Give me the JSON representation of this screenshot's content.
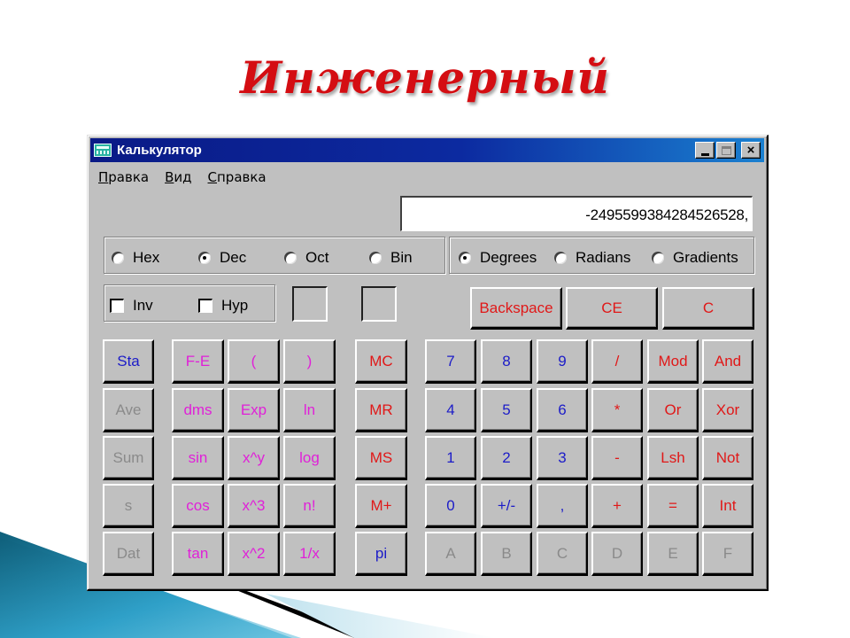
{
  "slide": {
    "title": "Инженерный",
    "title_color": "#d40d12",
    "accent_color": "#1a7fa0"
  },
  "window": {
    "title": "Калькулятор",
    "icon": "calculator-icon",
    "controls": {
      "minimize": "minimize-icon",
      "maximize": "maximize-icon",
      "close": "×"
    }
  },
  "menu": [
    {
      "label": "Правка",
      "mnemonic": "П",
      "rest": "равка"
    },
    {
      "label": "Вид",
      "mnemonic": "В",
      "rest": "ид"
    },
    {
      "label": "Справка",
      "mnemonic": "С",
      "rest": "правка"
    }
  ],
  "display": {
    "value": "-2495599384284526528,"
  },
  "number_system": {
    "options": [
      "Hex",
      "Dec",
      "Oct",
      "Bin"
    ],
    "selected": "Dec"
  },
  "angle_units": {
    "options": [
      "Degrees",
      "Radians",
      "Gradients"
    ],
    "selected": "Degrees"
  },
  "modifiers": [
    {
      "label": "Inv",
      "checked": false
    },
    {
      "label": "Hyp",
      "checked": false
    }
  ],
  "colors": {
    "blue": "#1c1cc8",
    "magenta": "#e020d8",
    "red": "#e01818",
    "gray": "#8a8a8a"
  },
  "edit_buttons": [
    "Backspace",
    "CE",
    "C"
  ],
  "stat_buttons": [
    {
      "label": "Sta",
      "color": "blue"
    },
    {
      "label": "Ave",
      "color": "gray"
    },
    {
      "label": "Sum",
      "color": "gray"
    },
    {
      "label": "s",
      "color": "gray"
    },
    {
      "label": "Dat",
      "color": "gray"
    }
  ],
  "function_buttons": [
    [
      "F-E",
      "(",
      ")"
    ],
    [
      "dms",
      "Exp",
      "ln"
    ],
    [
      "sin",
      "x^y",
      "log"
    ],
    [
      "cos",
      "x^3",
      "n!"
    ],
    [
      "tan",
      "x^2",
      "1/x"
    ]
  ],
  "memory_buttons": [
    {
      "label": "MC",
      "color": "red"
    },
    {
      "label": "MR",
      "color": "red"
    },
    {
      "label": "MS",
      "color": "red"
    },
    {
      "label": "M+",
      "color": "red"
    },
    {
      "label": "pi",
      "color": "blue"
    }
  ],
  "keypad": [
    [
      {
        "label": "7",
        "color": "blue"
      },
      {
        "label": "8",
        "color": "blue"
      },
      {
        "label": "9",
        "color": "blue"
      },
      {
        "label": "/",
        "color": "red"
      },
      {
        "label": "Mod",
        "color": "red"
      },
      {
        "label": "And",
        "color": "red"
      }
    ],
    [
      {
        "label": "4",
        "color": "blue"
      },
      {
        "label": "5",
        "color": "blue"
      },
      {
        "label": "6",
        "color": "blue"
      },
      {
        "label": "*",
        "color": "red"
      },
      {
        "label": "Or",
        "color": "red"
      },
      {
        "label": "Xor",
        "color": "red"
      }
    ],
    [
      {
        "label": "1",
        "color": "blue"
      },
      {
        "label": "2",
        "color": "blue"
      },
      {
        "label": "3",
        "color": "blue"
      },
      {
        "label": "-",
        "color": "red"
      },
      {
        "label": "Lsh",
        "color": "red"
      },
      {
        "label": "Not",
        "color": "red"
      }
    ],
    [
      {
        "label": "0",
        "color": "blue"
      },
      {
        "label": "+/-",
        "color": "blue"
      },
      {
        "label": ",",
        "color": "blue"
      },
      {
        "label": "+",
        "color": "red"
      },
      {
        "label": "=",
        "color": "red"
      },
      {
        "label": "Int",
        "color": "red"
      }
    ],
    [
      {
        "label": "A",
        "color": "gray"
      },
      {
        "label": "B",
        "color": "gray"
      },
      {
        "label": "C",
        "color": "gray"
      },
      {
        "label": "D",
        "color": "gray"
      },
      {
        "label": "E",
        "color": "gray"
      },
      {
        "label": "F",
        "color": "gray"
      }
    ]
  ]
}
